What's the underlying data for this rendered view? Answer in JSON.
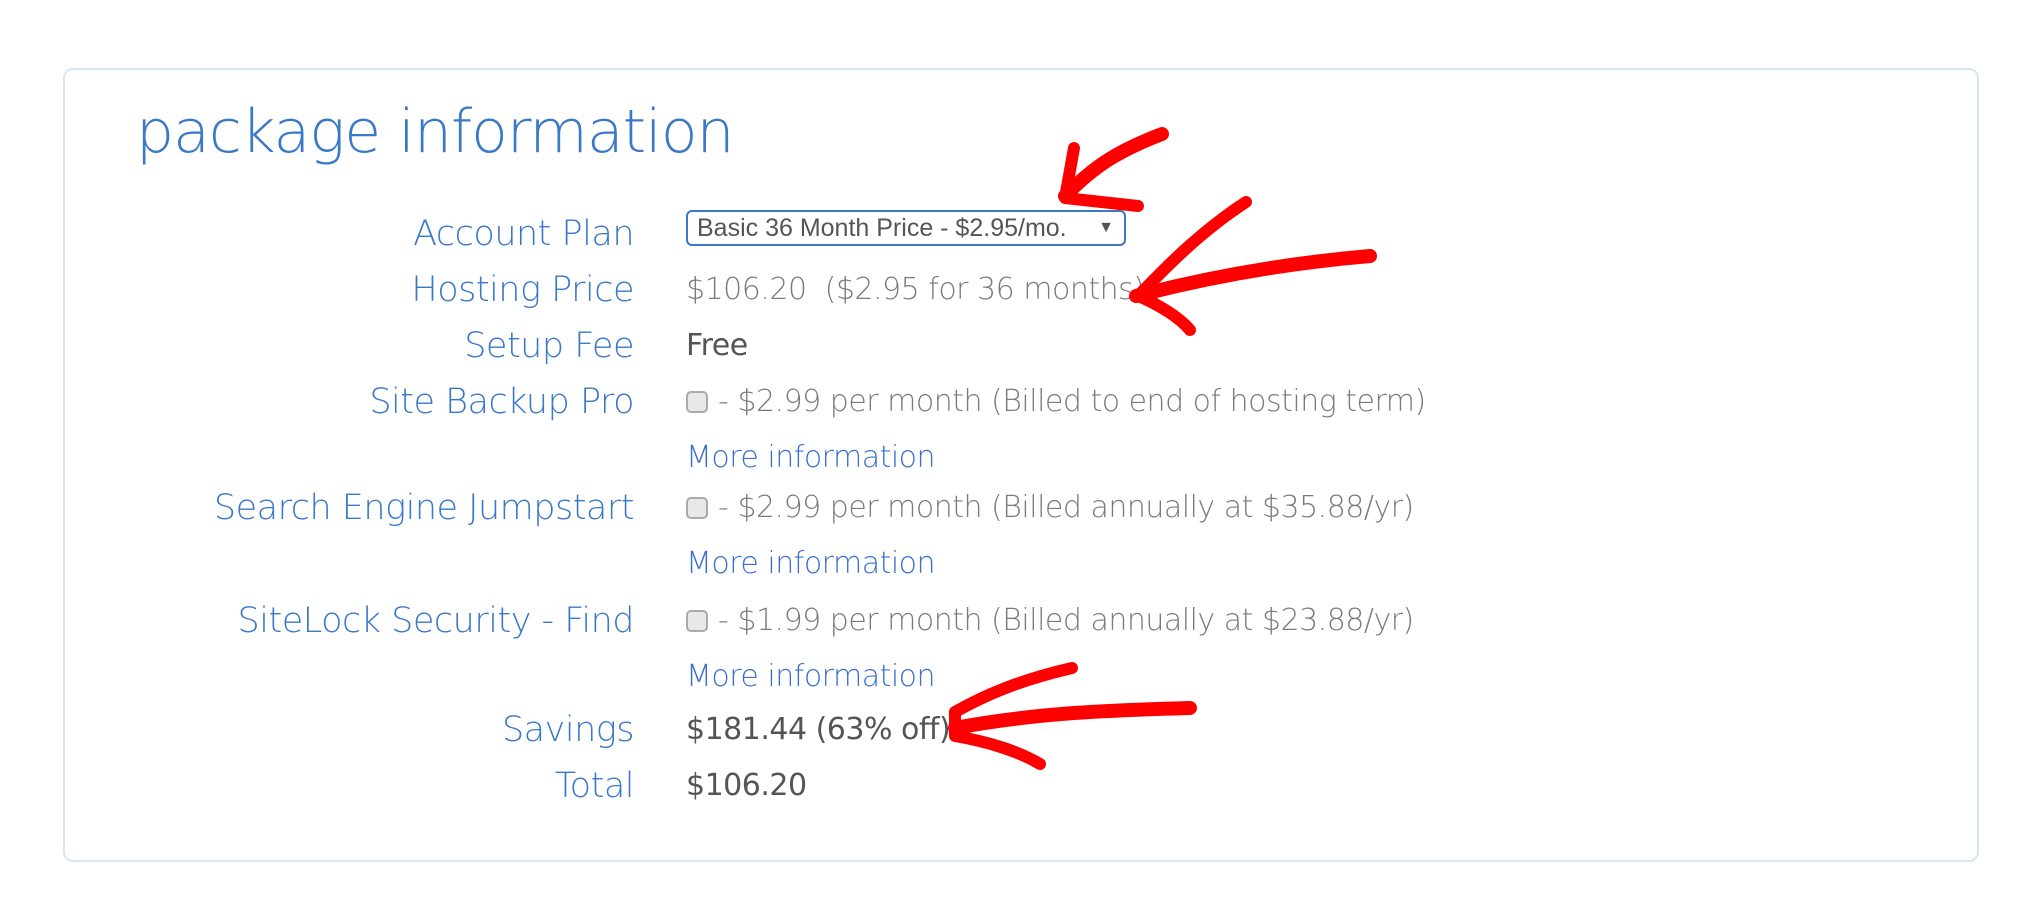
{
  "section": {
    "title": "package information"
  },
  "account_plan": {
    "label": "Account Plan",
    "selected": "Basic 36 Month Price - $2.95/mo.",
    "arrow": "▼"
  },
  "hosting_price": {
    "label": "Hosting Price",
    "value": "$106.20  ($2.95 for 36 months)"
  },
  "setup_fee": {
    "label": "Setup Fee",
    "value": "Free"
  },
  "addons": [
    {
      "label": "Site Backup Pro",
      "checked": false,
      "text": "- $2.99 per month (Billed to end of hosting term)",
      "link": "More information"
    },
    {
      "label": "Search Engine Jumpstart",
      "checked": false,
      "text": "- $2.99 per month (Billed annually at $35.88/yr)",
      "link": "More information"
    },
    {
      "label": "SiteLock Security - Find",
      "checked": false,
      "text": "- $1.99 per month (Billed annually at $23.88/yr)",
      "link": "More information"
    }
  ],
  "savings": {
    "label": "Savings",
    "value": "$181.44 (63% off)"
  },
  "total": {
    "label": "Total",
    "value": "$106.20"
  },
  "colors": {
    "accent": "#3a78c8",
    "border": "#d6e6f6",
    "annotation": "#ff0000",
    "muted_text": "#7a7a7a"
  }
}
